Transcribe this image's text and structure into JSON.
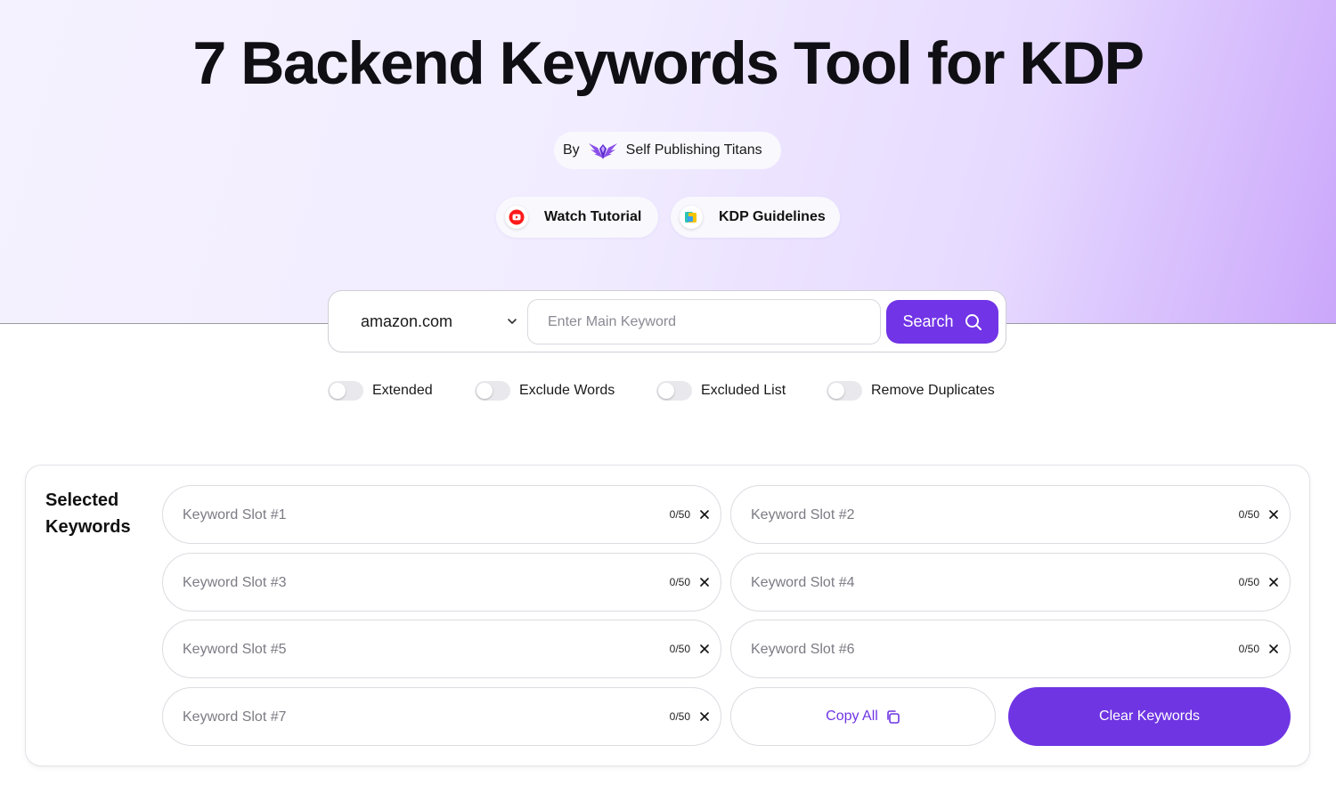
{
  "header": {
    "title": "7 Backend Keywords Tool for KDP",
    "by_label": "By",
    "brand": "Self Publishing Titans",
    "brand_icon": "wings-logo-icon"
  },
  "links": [
    {
      "label": "Watch Tutorial",
      "icon": "youtube-icon"
    },
    {
      "label": "KDP Guidelines",
      "icon": "guidelines-icon"
    }
  ],
  "search": {
    "marketplace": "amazon.com",
    "placeholder": "Enter Main Keyword",
    "value": "",
    "button_label": "Search"
  },
  "toggles": [
    {
      "label": "Extended",
      "on": false
    },
    {
      "label": "Exclude Words",
      "on": false
    },
    {
      "label": "Excluded List",
      "on": false
    },
    {
      "label": "Remove Duplicates",
      "on": false
    }
  ],
  "selected": {
    "title": "Selected Keywords",
    "slots": [
      {
        "placeholder": "Keyword Slot #1",
        "count": "0/50"
      },
      {
        "placeholder": "Keyword Slot #2",
        "count": "0/50"
      },
      {
        "placeholder": "Keyword Slot #3",
        "count": "0/50"
      },
      {
        "placeholder": "Keyword Slot #4",
        "count": "0/50"
      },
      {
        "placeholder": "Keyword Slot #5",
        "count": "0/50"
      },
      {
        "placeholder": "Keyword Slot #6",
        "count": "0/50"
      },
      {
        "placeholder": "Keyword Slot #7",
        "count": "0/50"
      }
    ],
    "copy_label": "Copy All",
    "clear_label": "Clear Keywords"
  },
  "colors": {
    "accent": "#7134e6",
    "youtube_red": "#ff0000"
  }
}
